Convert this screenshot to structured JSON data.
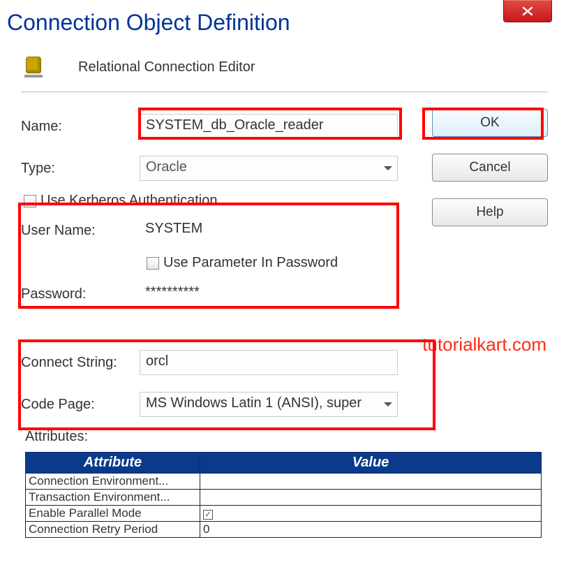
{
  "close_icon": "x",
  "dialog_title": "Connection Object Definition",
  "header_title": "Relational Connection Editor",
  "buttons": {
    "ok": "OK",
    "cancel": "Cancel",
    "help": "Help"
  },
  "labels": {
    "name": "Name:",
    "type": "Type:",
    "kerberos": "Use Kerberos Authentication",
    "user_name": "User Name:",
    "use_param_pw": "Use Parameter In Password",
    "password": "Password:",
    "connect_string": "Connect String:",
    "code_page": "Code Page:",
    "attributes": "Attributes:"
  },
  "values": {
    "name": "SYSTEM_db_Oracle_reader",
    "type": "Oracle",
    "user_name": "SYSTEM",
    "password": "**********",
    "connect_string": "orcl",
    "code_page": "MS Windows Latin 1 (ANSI), super"
  },
  "watermark": "tutorialkart.com",
  "attr_table": {
    "headers": [
      "Attribute",
      "Value"
    ],
    "rows": [
      {
        "attr": "Connection Environment...",
        "value": ""
      },
      {
        "attr": "Transaction Environment...",
        "value": ""
      },
      {
        "attr": "Enable Parallel Mode",
        "value_checked": true
      },
      {
        "attr": "Connection Retry Period",
        "value": "0"
      }
    ]
  }
}
